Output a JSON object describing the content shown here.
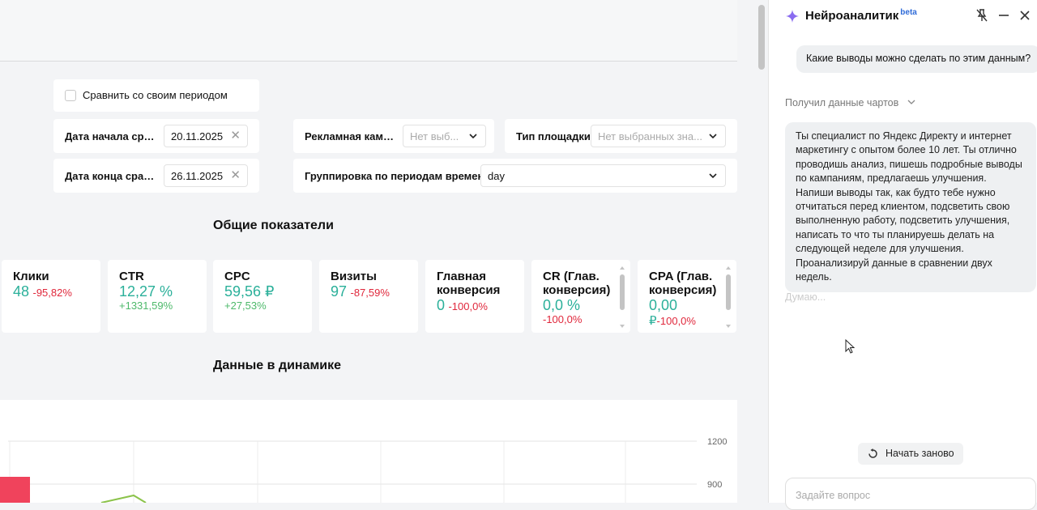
{
  "filters": {
    "compare_label": "Сравнить со своим периодом",
    "start_label": "Дата начала срав...",
    "start_value": "20.11.2025",
    "end_label": "Дата конца сравн...",
    "end_value": "26.11.2025",
    "campaign_label": "Рекламная кампа...",
    "campaign_placeholder": "Нет выб...",
    "platform_label": "Тип площадки",
    "platform_placeholder": "Нет выбранных зна...",
    "grouping_label": "Группировка по периодам времени",
    "grouping_value": "day"
  },
  "sections": {
    "general": "Общие показатели",
    "dynamics": "Данные в динамике"
  },
  "metrics": [
    {
      "title": "Клики",
      "value": "48",
      "change": "-95,82%"
    },
    {
      "title": "CTR",
      "value": "12,27 %",
      "change": "+1331,59%"
    },
    {
      "title": "CPC",
      "value": "59,56 ₽",
      "change": "+27,53%"
    },
    {
      "title": "Визиты",
      "value": "97",
      "change": "-87,59%"
    },
    {
      "title": "Главная конверсия",
      "value": "0",
      "change": "-100,0%"
    },
    {
      "title": "CR (Глав. конверсия)",
      "value": "0,0 %",
      "change": "-100,0%"
    },
    {
      "title": "CPA (Глав. конверсия)",
      "value": "0,00",
      "value_suffix": "₽",
      "change": "-100,0%"
    }
  ],
  "chart_data": {
    "type": "line",
    "y_ticks": [
      "1200",
      "900"
    ]
  },
  "panel": {
    "title": "Нейроаналитик",
    "badge": "beta",
    "user_question": "Какие выводы можно сделать по этим данным?",
    "got_data": "Получил данные чартов",
    "prompt_text": "Ты специалист по Яндекс Директу и интернет маркетингу с опытом более 10 лет. Ты отлично проводишь анализ, пишешь подробные выводы по кампаниям, предлагаешь улучшения. Напиши выводы так, как будто тебе нужно отчитаться перед клиентом, подсветить свою выполненную работу, подсветить улучшения, написать то что ты планируешь делать на следующей неделе для улучшения. Проанализируй данные в сравнении двух недель.",
    "thinking": "Думаю...",
    "restart_label": "Начать заново",
    "ask_placeholder": "Задайте вопрос"
  },
  "colors": {
    "accent": "#2bb09a",
    "negative": "#e0283c",
    "positive": "#4db96a",
    "badge": "#2f6bd8"
  }
}
